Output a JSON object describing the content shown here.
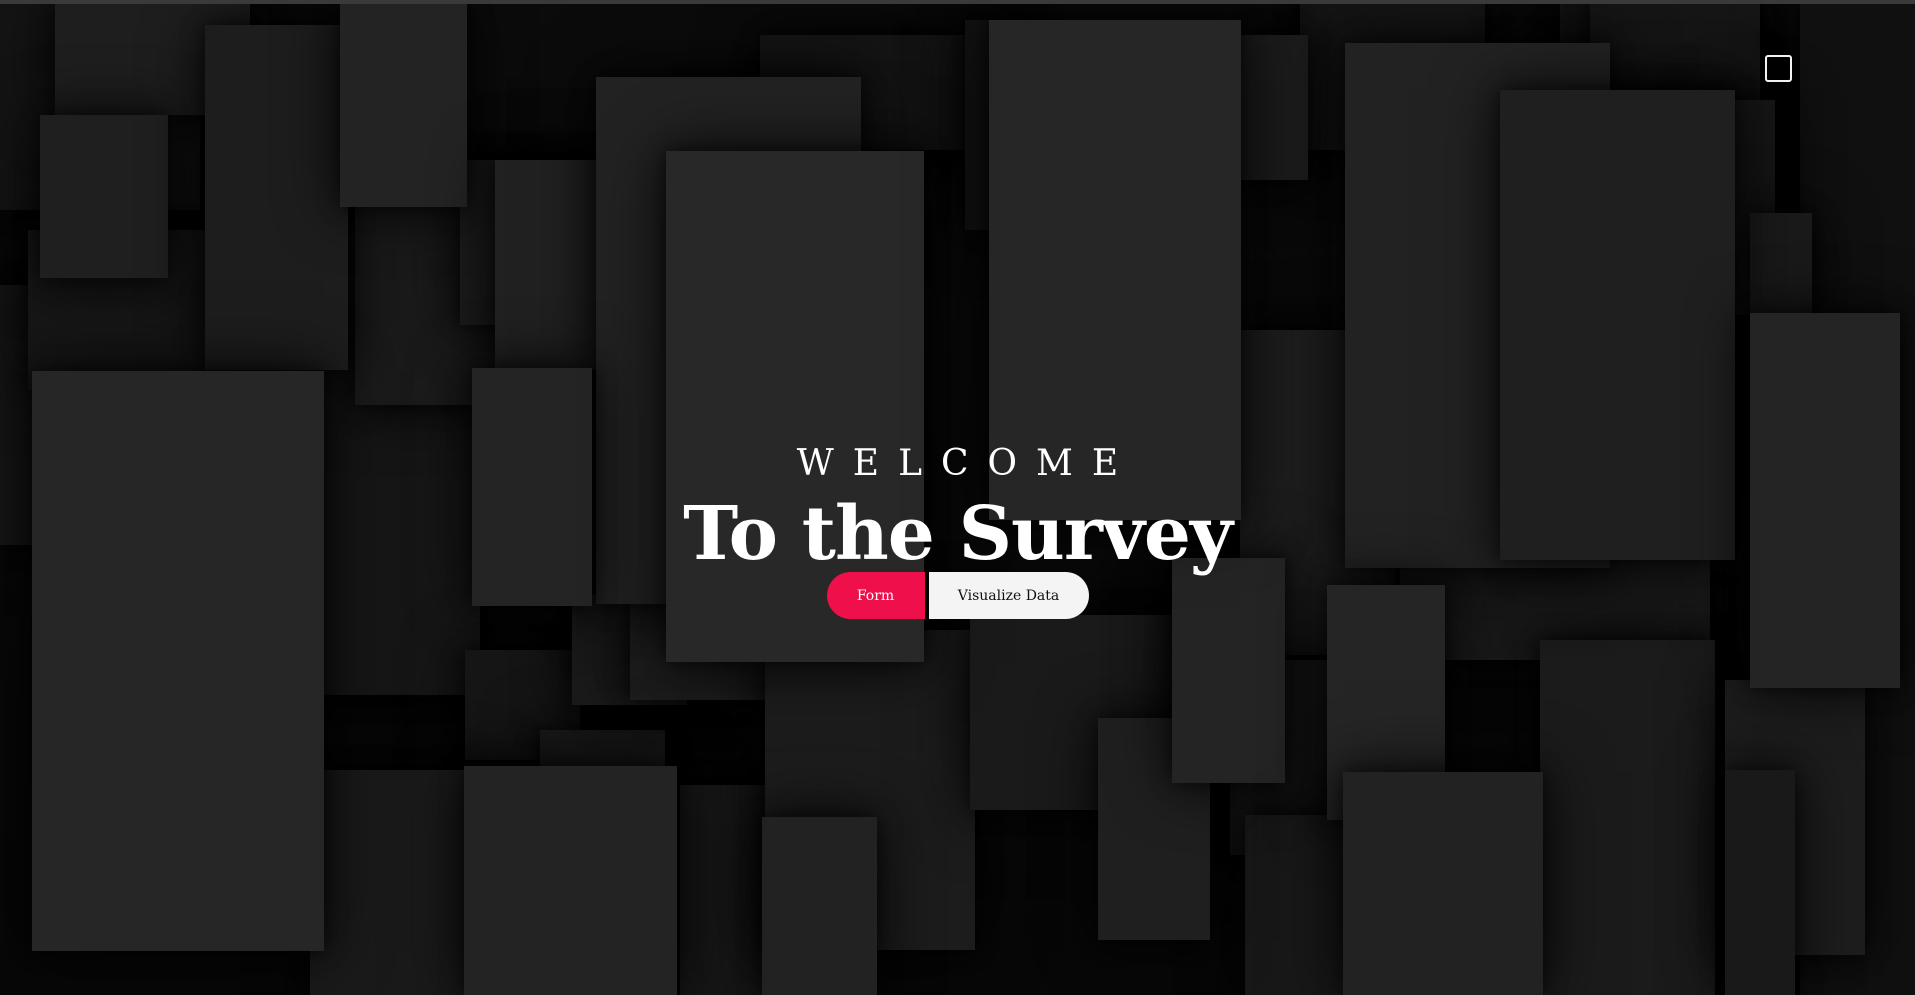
{
  "hero": {
    "welcome": "WELCOME",
    "title": "To the Survey"
  },
  "actions": {
    "form_label": "Form",
    "visualize_label": "Visualize Data"
  },
  "icons": {
    "menu_toggle": "menu-toggle-icon"
  },
  "colors": {
    "accent": "#ef0f4a",
    "secondary_button": "#f4f4f4",
    "text": "#ffffff"
  }
}
